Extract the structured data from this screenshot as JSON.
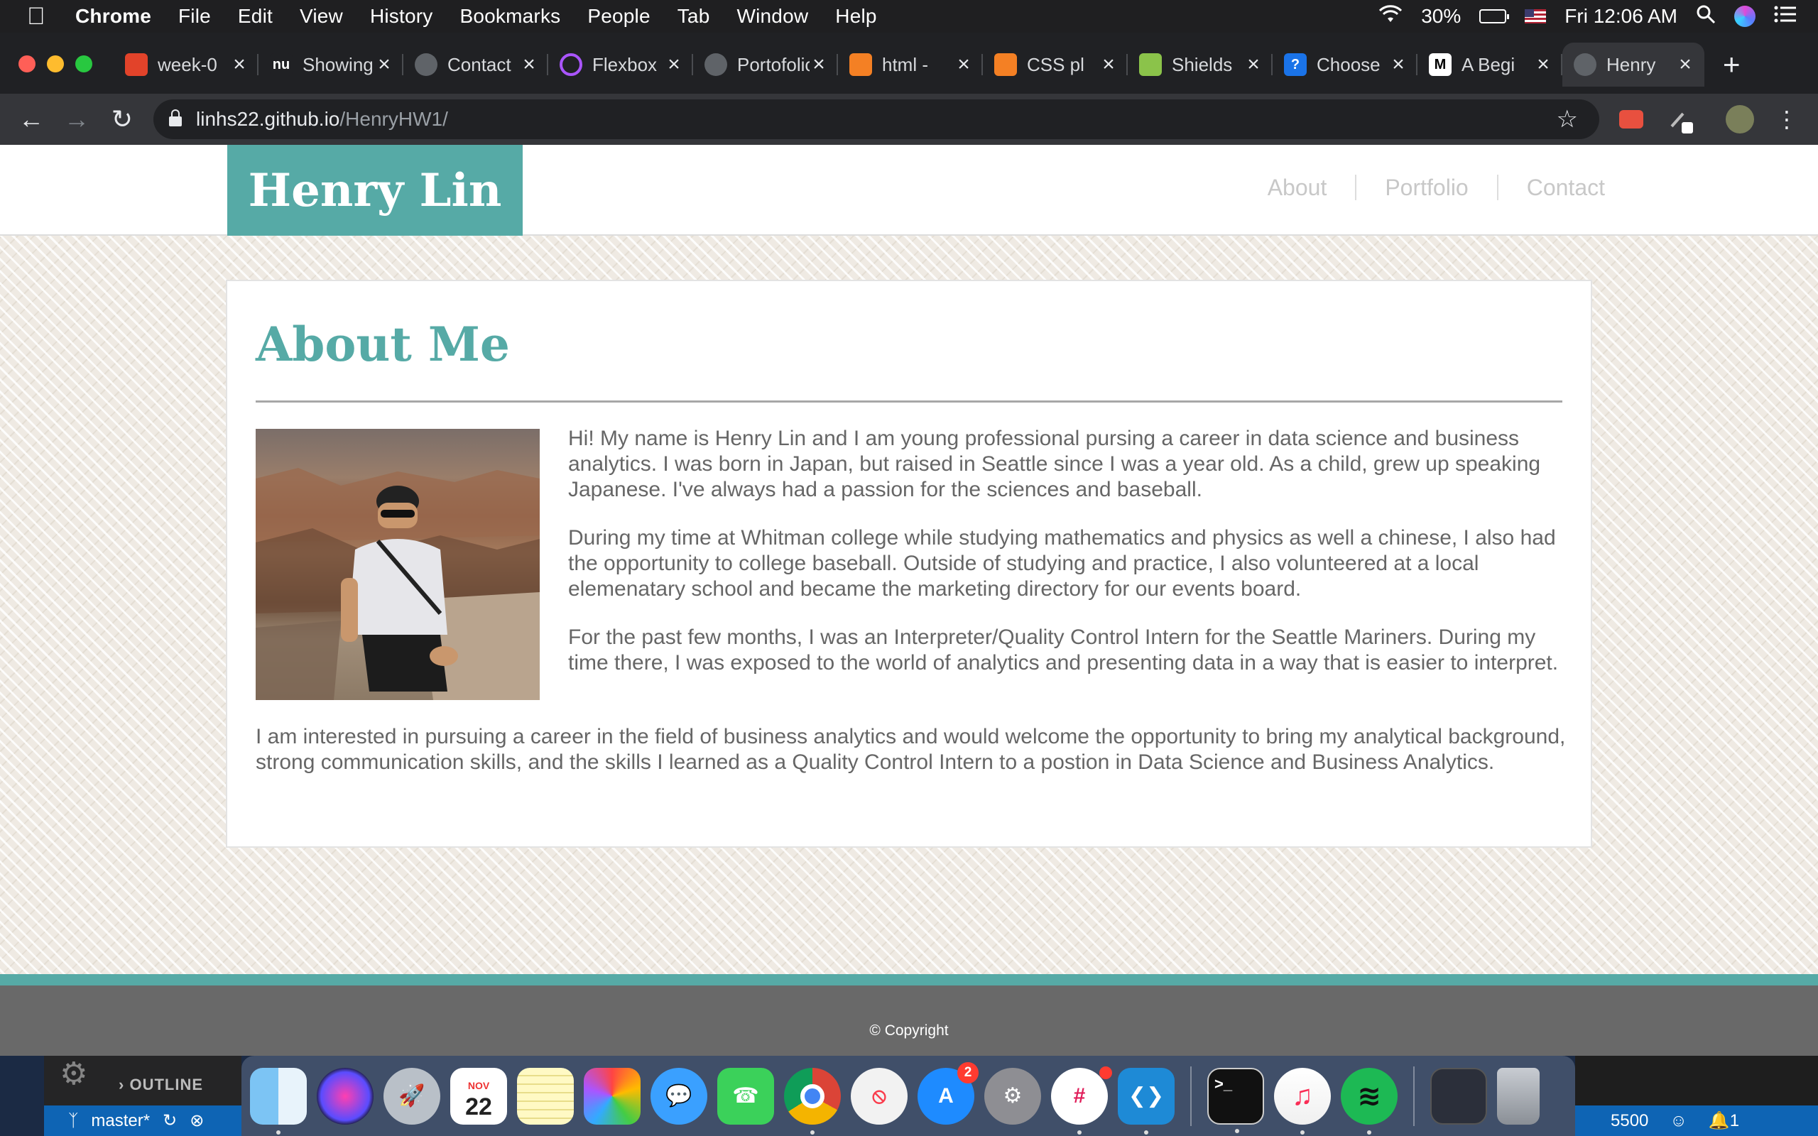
{
  "menubar": {
    "app_name": "Chrome",
    "menus": [
      "File",
      "Edit",
      "View",
      "History",
      "Bookmarks",
      "People",
      "Tab",
      "Window",
      "Help"
    ],
    "battery": "30%",
    "clock": "Fri 12:06 AM"
  },
  "tabs": [
    {
      "label": "week-0",
      "favicon": "gitlab-icon",
      "color": "#e2432a",
      "glyph": ""
    },
    {
      "label": "Showing",
      "favicon": "nu-icon",
      "color": "#202124",
      "glyph": "nu"
    },
    {
      "label": "Contact",
      "favicon": "globe-icon",
      "color": "#5f6368",
      "glyph": ""
    },
    {
      "label": "Flexbox",
      "favicon": "ring-icon",
      "color": "#202124",
      "glyph": ""
    },
    {
      "label": "Portofolio",
      "favicon": "globe-icon",
      "color": "#5f6368",
      "glyph": ""
    },
    {
      "label": "html -",
      "favicon": "stackoverflow-icon",
      "color": "#f48024",
      "glyph": ""
    },
    {
      "label": "CSS pl",
      "favicon": "stackoverflow-icon",
      "color": "#f48024",
      "glyph": ""
    },
    {
      "label": "Shields",
      "favicon": "shield-icon",
      "color": "#8bc34a",
      "glyph": ""
    },
    {
      "label": "Choose",
      "favicon": "question-icon",
      "color": "#1a73e8",
      "glyph": "?"
    },
    {
      "label": "A Begi",
      "favicon": "medium-icon",
      "color": "#000000",
      "glyph": "M"
    },
    {
      "label": "Henry",
      "favicon": "globe-icon",
      "color": "#5f6368",
      "glyph": "",
      "active": true
    }
  ],
  "toolbar": {
    "url_host": "linhs22.github.io",
    "url_path": "/HenryHW1/"
  },
  "site": {
    "brand": "Henry Lin",
    "nav": [
      "About",
      "Portfolio",
      "Contact"
    ],
    "heading": "About Me",
    "paragraphs": [
      "Hi! My name is Henry Lin and I am young professional pursing a career in data science and business analytics. I was born in Japan, but raised in Seattle since I was a year old. As a child, grew up speaking Japanese. I've always had a passion for the sciences and baseball.",
      "During my time at Whitman college while studying mathematics and physics as well a chinese, I also had the opportunity to college baseball. Outside of studying and practice, I also volunteered at a local elemenatary school and became the marketing directory for our events board.",
      "For the past few months, I was an Interpreter/Quality Control Intern for the Seattle Mariners. During my time there, I was exposed to the world of analytics and presenting data in a way that is easier to interpret."
    ],
    "closing": "I am interested in pursuing a career in the field of business analytics and would welcome the opportunity to bring my analytical background, strong communication skills, and the skills I learned as a Quality Control Intern to a postion in Data Science and Business Analytics.",
    "copyright": "© Copyright",
    "accent_color": "#56aaa6"
  },
  "vscode": {
    "outline_label": "OUTLINE",
    "branch": "master*",
    "port": "5500",
    "notifications": "1"
  },
  "dock": {
    "calendar_month": "NOV",
    "calendar_day": "22",
    "appstore_badge": "2"
  }
}
